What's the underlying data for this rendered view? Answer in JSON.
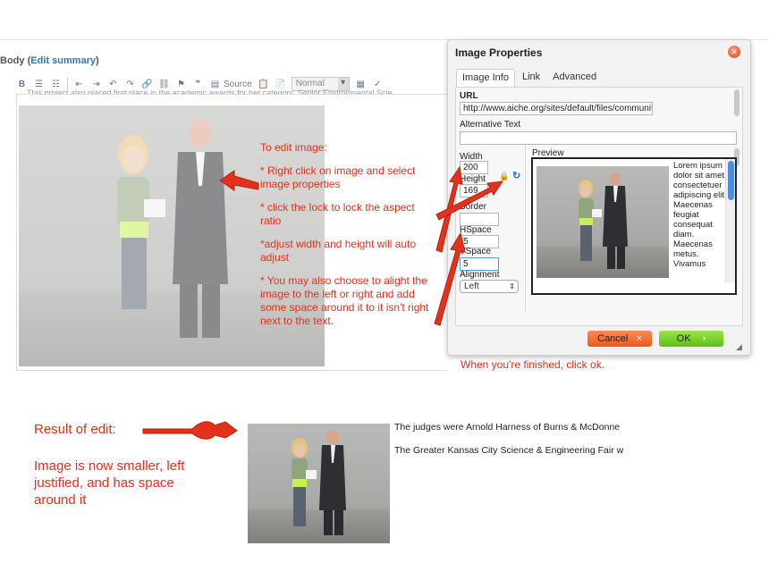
{
  "editor": {
    "body_label": "Body",
    "edit_summary_link": "Edit summary",
    "paren_open": "(",
    "paren_close": ")",
    "toolbar": {
      "source_label": "Source",
      "format_value": "Normal",
      "icons": [
        "bold-icon",
        "bulleted-list-icon",
        "numbered-list-icon",
        "outdent-icon",
        "indent-icon",
        "undo-icon",
        "redo-icon",
        "link-icon",
        "unlink-icon",
        "anchor-icon",
        "blockquote-icon",
        "source-icon",
        "paste-text-icon",
        "paste-word-icon",
        "table-icon",
        "spellcheck-icon"
      ]
    },
    "cut_off_line": "This project also placed first place in the academic awards for her category, Senior Environmental Scie..."
  },
  "instructions": {
    "heading": "To edit image:",
    "step1": "* Right click on image and select image properties",
    "step2": "* click the lock to lock the aspect ratio",
    "step3": "*adjust width and height will auto adjust",
    "step4": "* You may also choose to alight the image to the left or right and add some space around it to it isn't right next to the text."
  },
  "dialog": {
    "title": "Image Properties",
    "tabs": [
      "Image Info",
      "Link",
      "Advanced"
    ],
    "active_tab": "Image Info",
    "url_label": "URL",
    "url_value": "http://www.aiche.org/sites/default/files/community/aich",
    "alt_label": "Alternative Text",
    "alt_value": "",
    "width_label": "Width",
    "width_value": "200",
    "height_label": "Height",
    "height_value": "169",
    "border_label": "Border",
    "border_value": "",
    "hspace_label": "HSpace",
    "hspace_value": "5",
    "vspace_label": "VSpace",
    "vspace_value": "5",
    "alignment_label": "Alignment",
    "alignment_value": "Left",
    "preview_label": "Preview",
    "preview_text": "Lorem ipsum dolor sit amet, consectetuer adipiscing elit. Maecenas feugiat consequat diam. Maecenas metus. Vivamus",
    "cancel_label": "Cancel",
    "ok_label": "OK",
    "cancel_mark": "×",
    "ok_mark": "›"
  },
  "finished_note": "When you're finished, click ok.",
  "result": {
    "label": "Result of edit:",
    "description": "Image is now smaller, left justified, and has space around it",
    "line1": "The judges were Arnold Harness of Burns & McDonne",
    "line2": "The Greater Kansas City Science & Engineering Fair w"
  },
  "colors": {
    "annotation_red": "#e3311b",
    "cancel_orange": "#e85a1c",
    "ok_green": "#5fbf14",
    "link_blue": "#2a7ab0"
  }
}
